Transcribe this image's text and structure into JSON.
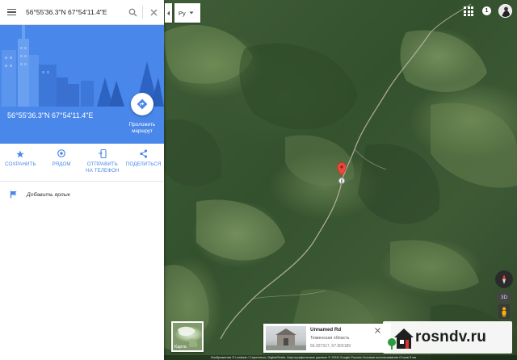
{
  "search": {
    "query": "56°55'36.3\"N 67°54'11.4\"E"
  },
  "place": {
    "title": "56°55'36.3\"N 67°54'11.4\"E",
    "directions_label_line1": "Проложить",
    "directions_label_line2": "маршрут"
  },
  "actions": [
    {
      "label_line1": "СОХРАНИТЬ",
      "label_line2": "",
      "icon": "star-icon"
    },
    {
      "label_line1": "РЯДОМ",
      "label_line2": "",
      "icon": "nearby-icon"
    },
    {
      "label_line1": "ОТПРАВИТЬ",
      "label_line2": "НА ТЕЛЕФОН",
      "icon": "send-to-phone-icon"
    },
    {
      "label_line1": "ПОДЕЛИТЬСЯ",
      "label_line2": "",
      "icon": "share-icon"
    }
  ],
  "add_label": "Добавить ярлык",
  "language": "Ру",
  "notifications_count": "1",
  "map_controls": {
    "view_3d": "3D"
  },
  "minimap": {
    "label": "Карта"
  },
  "street_view_card": {
    "title": "Unnamed Rd",
    "subtitle": "Тюменская область",
    "coordinates": "56.927317, 67.903189"
  },
  "watermark": {
    "text": "rosndv.ru"
  },
  "attribution": "Изображения © Landsat / Copernicus, DigitalGlobe, Картографические данные © 2018 Google  Россия  Условия использования  Отзыв  5 км",
  "colors": {
    "accent_blue": "#4a87ea",
    "pin_red": "#e64a3c",
    "forest_dark": "#34512e"
  }
}
